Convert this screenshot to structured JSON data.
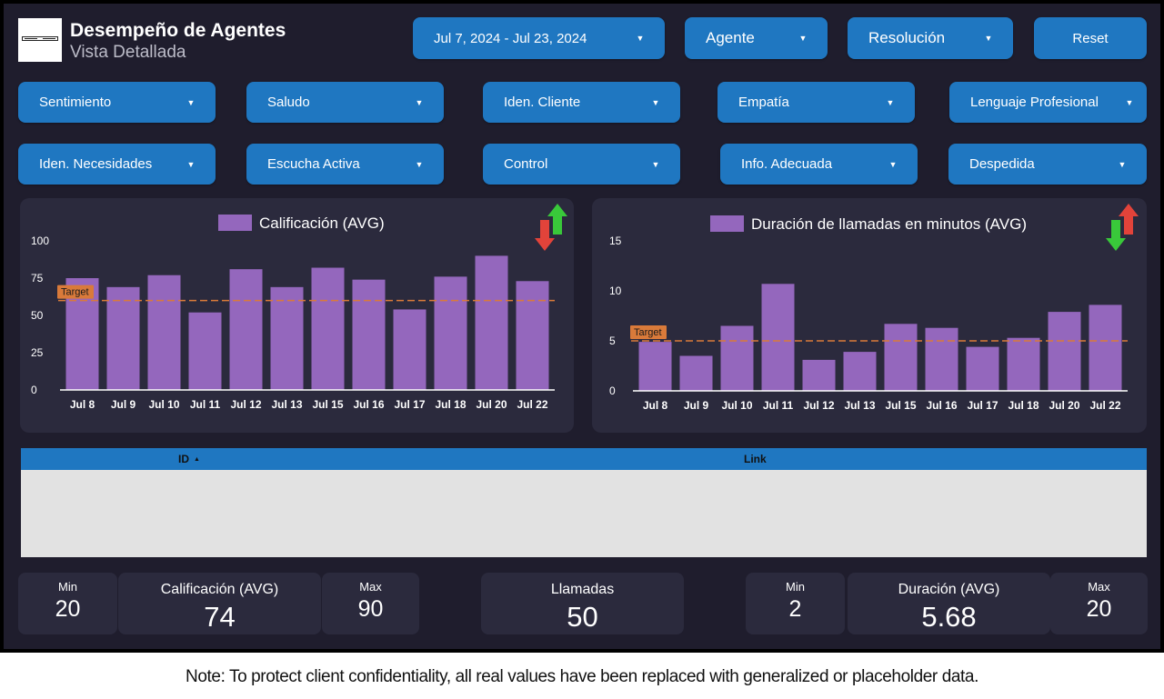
{
  "header": {
    "title": "Desempeño de Agentes",
    "subtitle": "Vista Detallada"
  },
  "controls": {
    "date_range": "Jul 7, 2024 - Jul 23, 2024",
    "agent": "Agente",
    "resolution": "Resolución",
    "reset": "Reset"
  },
  "filters_row1": [
    "Sentimiento",
    "Saludo",
    "Iden. Cliente",
    "Empatía",
    "Lenguaje Profesional"
  ],
  "filters_row2": [
    "Iden. Necesidades",
    "Escucha Activa",
    "Control",
    "Info. Adecuada",
    "Despedida"
  ],
  "chart_data": [
    {
      "type": "bar",
      "title": "Calificación (AVG)",
      "series": [
        {
          "name": "Calificación (AVG)",
          "values": [
            75,
            69,
            77,
            52,
            81,
            69,
            82,
            74,
            54,
            76,
            90,
            73
          ]
        }
      ],
      "categories": [
        "Jul 8",
        "Jul 9",
        "Jul 10",
        "Jul 11",
        "Jul 12",
        "Jul 13",
        "Jul 15",
        "Jul 16",
        "Jul 17",
        "Jul 18",
        "Jul 20",
        "Jul 22"
      ],
      "ylim": [
        0,
        100
      ],
      "yticks": [
        0,
        25,
        50,
        75,
        100
      ],
      "target": 60,
      "target_label": "Target",
      "bar_color": "#9467bd",
      "target_color": "#d97a3a",
      "trend_icon": "arrow-up-green-down-red-icon"
    },
    {
      "type": "bar",
      "title": "Duración de llamadas en minutos (AVG)",
      "series": [
        {
          "name": "Duración de llamadas en minutos (AVG)",
          "values": [
            4.9,
            3.5,
            6.5,
            10.7,
            3.1,
            3.9,
            6.7,
            6.3,
            4.4,
            5.3,
            7.9,
            8.6
          ]
        }
      ],
      "categories": [
        "Jul 8",
        "Jul 9",
        "Jul 10",
        "Jul 11",
        "Jul 12",
        "Jul 13",
        "Jul 15",
        "Jul 16",
        "Jul 17",
        "Jul 18",
        "Jul 20",
        "Jul 22"
      ],
      "ylim": [
        0,
        15
      ],
      "yticks": [
        0,
        5,
        10,
        15
      ],
      "target": 5,
      "target_label": "Target",
      "bar_color": "#9467bd",
      "target_color": "#d97a3a",
      "trend_icon": "arrow-down-green-up-red-icon"
    }
  ],
  "table": {
    "columns": [
      "ID",
      "Link"
    ],
    "sort_icon": "sort-ascending-icon"
  },
  "kpis": {
    "score_min_label": "Min",
    "score_min": "20",
    "score_avg_label": "Calificación (AVG)",
    "score_avg": "74",
    "score_max_label": "Max",
    "score_max": "90",
    "calls_label": "Llamadas",
    "calls": "50",
    "dur_min_label": "Min",
    "dur_min": "2",
    "dur_avg_label": "Duración (AVG)",
    "dur_avg": "5.68",
    "dur_max_label": "Max",
    "dur_max": "20"
  },
  "colors": {
    "background": "#1f1d2d",
    "panel": "#2b2a3d",
    "button": "#1f77c1",
    "bar": "#9467bd",
    "target": "#d97a3a"
  },
  "footer_note": "Note: To protect client confidentiality, all real values have been replaced with generalized or placeholder data."
}
